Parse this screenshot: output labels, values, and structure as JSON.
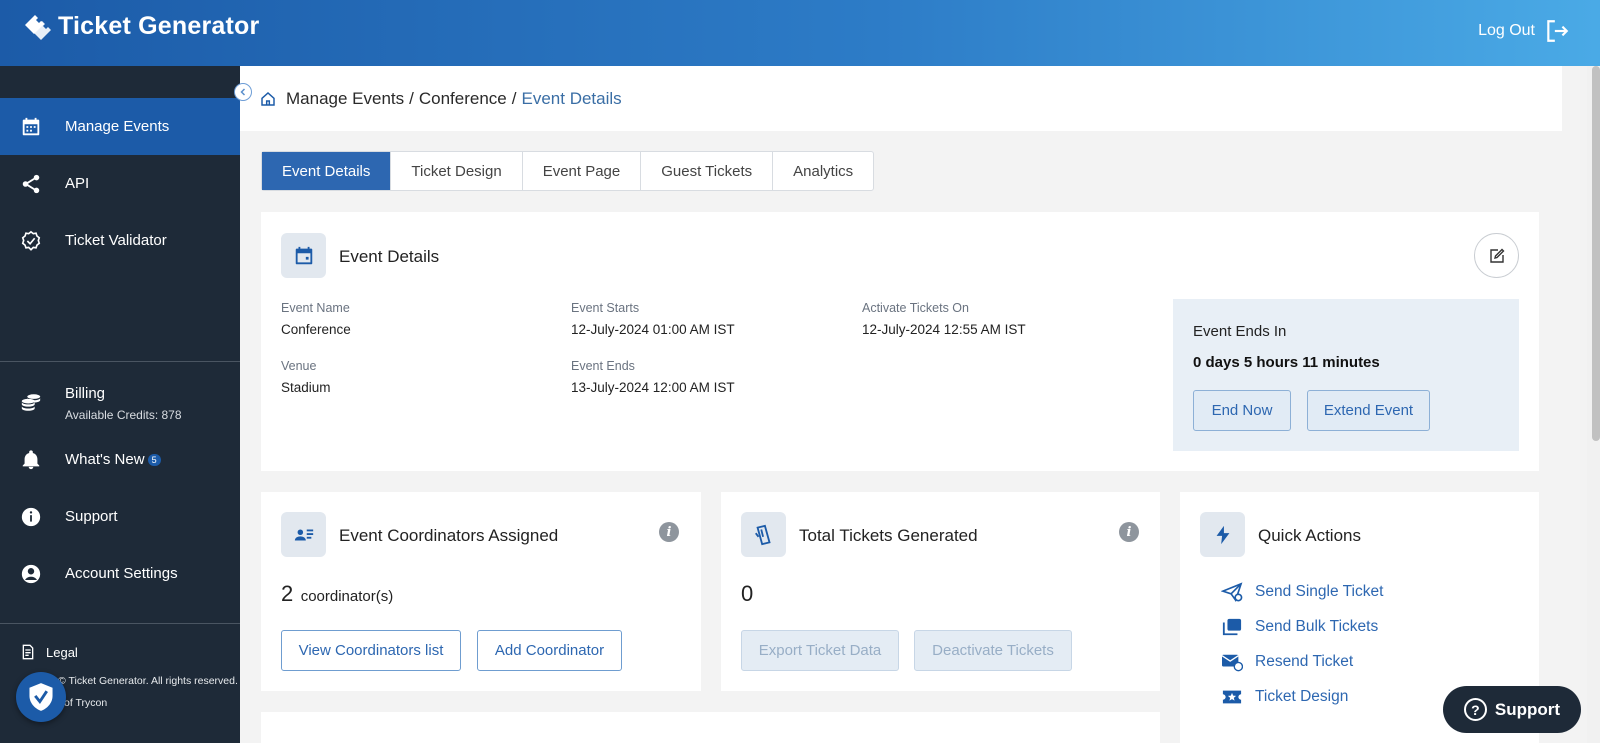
{
  "app": {
    "title": "Ticket Generator",
    "logout_label": "Log Out"
  },
  "sidebar": {
    "items": [
      {
        "label": "Manage Events",
        "icon": "calendar-icon",
        "active": true
      },
      {
        "label": "API",
        "icon": "share-icon",
        "active": false
      },
      {
        "label": "Ticket Validator",
        "icon": "verified-badge-icon",
        "active": false
      }
    ],
    "billing": {
      "label": "Billing",
      "credits": "Available Credits: 878"
    },
    "whats_new": {
      "label": "What's New",
      "badge": "5"
    },
    "support_label": "Support",
    "account_settings_label": "Account Settings",
    "legal_label": "Legal",
    "footer_line1": "© Ticket Generator. All rights reserved.",
    "footer_line2": "of Trycon"
  },
  "breadcrumb": {
    "items": [
      "Manage Events",
      "Conference"
    ],
    "separator": "/",
    "current": "Event Details"
  },
  "tabs": [
    "Event Details",
    "Ticket Design",
    "Event Page",
    "Guest Tickets",
    "Analytics"
  ],
  "event_details": {
    "title": "Event Details",
    "fields": {
      "event_name_label": "Event Name",
      "event_name": "Conference",
      "venue_label": "Venue",
      "venue": "Stadium",
      "event_starts_label": "Event Starts",
      "event_starts": "12-July-2024 01:00 AM IST",
      "event_ends_label": "Event Ends",
      "event_ends": "13-July-2024 12:00 AM IST",
      "activate_label": "Activate Tickets On",
      "activate": "12-July-2024 12:55 AM IST"
    },
    "ends_in": {
      "label": "Event Ends In",
      "value": "0 days 5 hours 11 minutes",
      "end_now": "End Now",
      "extend": "Extend Event"
    }
  },
  "coordinators": {
    "title": "Event Coordinators Assigned",
    "count": "2",
    "unit": "coordinator(s)",
    "view_button": "View Coordinators list",
    "add_button": "Add Coordinator"
  },
  "tickets": {
    "title": "Total Tickets Generated",
    "count": "0",
    "export_button": "Export Ticket Data",
    "deactivate_button": "Deactivate Tickets"
  },
  "quick_actions": {
    "title": "Quick Actions",
    "links": [
      {
        "label": "Send Single Ticket",
        "icon": "paper-plane-icon"
      },
      {
        "label": "Send Bulk Tickets",
        "icon": "stacked-cards-icon"
      },
      {
        "label": "Resend Ticket",
        "icon": "mail-refresh-icon"
      },
      {
        "label": "Ticket Design",
        "icon": "ticket-star-icon"
      }
    ]
  },
  "support_fab": {
    "label": "Support"
  },
  "colors": {
    "brand": "#1c5ba8",
    "sidebar": "#1e2a38",
    "accent": "#2d67b1"
  }
}
